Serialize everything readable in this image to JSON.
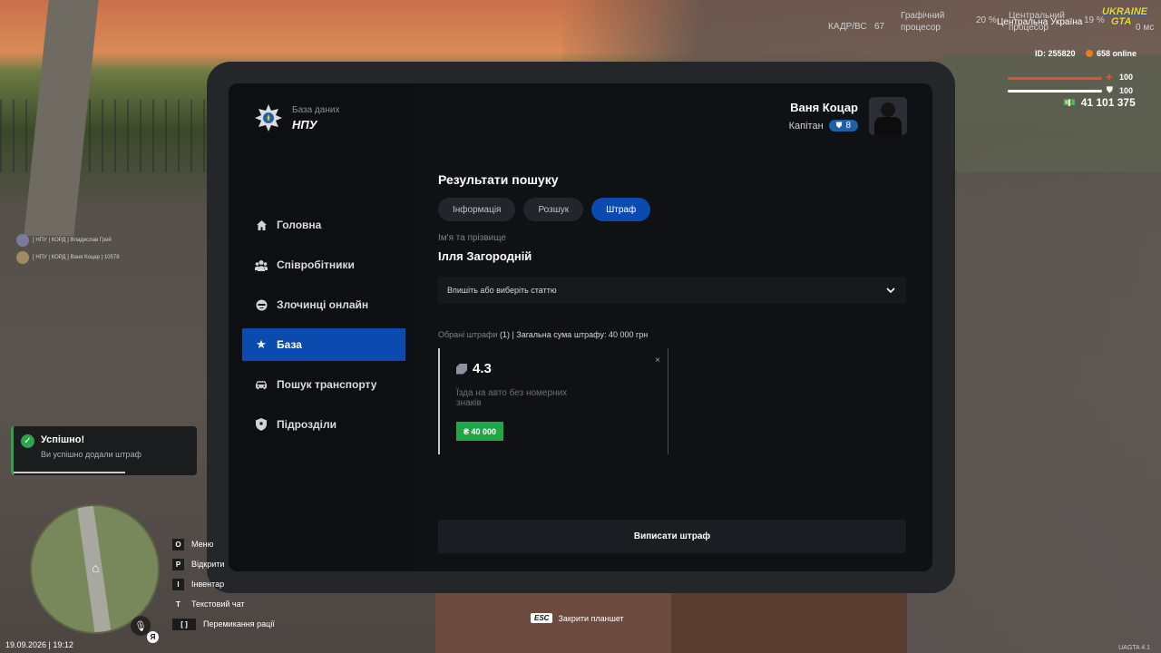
{
  "hud": {
    "fps_label": "КАДР/ВС",
    "fps_value": "67",
    "gpu_label_1": "Графічний",
    "gpu_label_2": "процесор",
    "gpu_value": "20 %",
    "cpu_label_1": "Центральний",
    "cpu_label_2": "процесор",
    "region": "Центральна Україна",
    "region_value": "19 %",
    "ping": "0 мс",
    "logo_text_1": "UKRAINE",
    "logo_text_2": "GTA",
    "player_id": "ID: 255820",
    "online": "658 online",
    "health": "100",
    "health_fraction": 1.0,
    "armor": "100",
    "armor_fraction": 1.0,
    "money": "41 101 375",
    "health_color": "#e74c3c",
    "armor_color": "#ffffff"
  },
  "chat": [
    "[ НПУ | КОРД ] Владислав Грей",
    "[ НПУ | КОРД ] Ваня Коцар | 10578"
  ],
  "tablet": {
    "brand_sub": "База даних",
    "brand_title": "НПУ",
    "user_name": "Ваня Коцар",
    "user_rank": "Капітан",
    "user_level": "8",
    "nav": [
      {
        "label": "Головна",
        "icon": "home-icon"
      },
      {
        "label": "Співробітники",
        "icon": "users-icon"
      },
      {
        "label": "Злочинці онлайн",
        "icon": "criminal-icon"
      },
      {
        "label": "База",
        "icon": "star-icon"
      },
      {
        "label": "Пошук транспорту",
        "icon": "car-icon"
      },
      {
        "label": "Підрозділи",
        "icon": "shield-icon"
      }
    ],
    "active_nav": "База",
    "title": "Результати пошуку",
    "tabs": [
      "Інформація",
      "Розшук",
      "Штраф"
    ],
    "active_tab": "Штраф",
    "name_label": "Ім'я та прізвище",
    "name_value": "Ілля Загородній",
    "select_placeholder": "Впишіть або виберіть статтю",
    "summary_label": "Обрані штрафи",
    "summary_value": "(1) | Загальна сума штрафу: 40 000 грн",
    "fine": {
      "article": "4.3",
      "description": "Їзда на авто без номерних знаків",
      "amount": "₴ 40 000",
      "close": "×"
    },
    "issue_button": "Виписати штраф",
    "accent_color": "#0b4bb0",
    "success_color": "#1fa74a"
  },
  "notification": {
    "title": "Успішно!",
    "text": "Ви успішно додали штраф",
    "progress": 0.6
  },
  "keys": [
    {
      "key": "O",
      "label": "Меню"
    },
    {
      "key": "P",
      "label": "Відкрити"
    },
    {
      "key": "I",
      "label": "Інвентар"
    },
    {
      "key": "T",
      "label": "Текстовий чат"
    },
    {
      "key": "[ ]",
      "label": "Перемикання рації"
    }
  ],
  "mic_key": "Я",
  "datetime": "19.09.2026 | 19:12",
  "esc": {
    "key": "ESC",
    "label": "Закрити планшет"
  },
  "version": "UAGTA 4.1"
}
